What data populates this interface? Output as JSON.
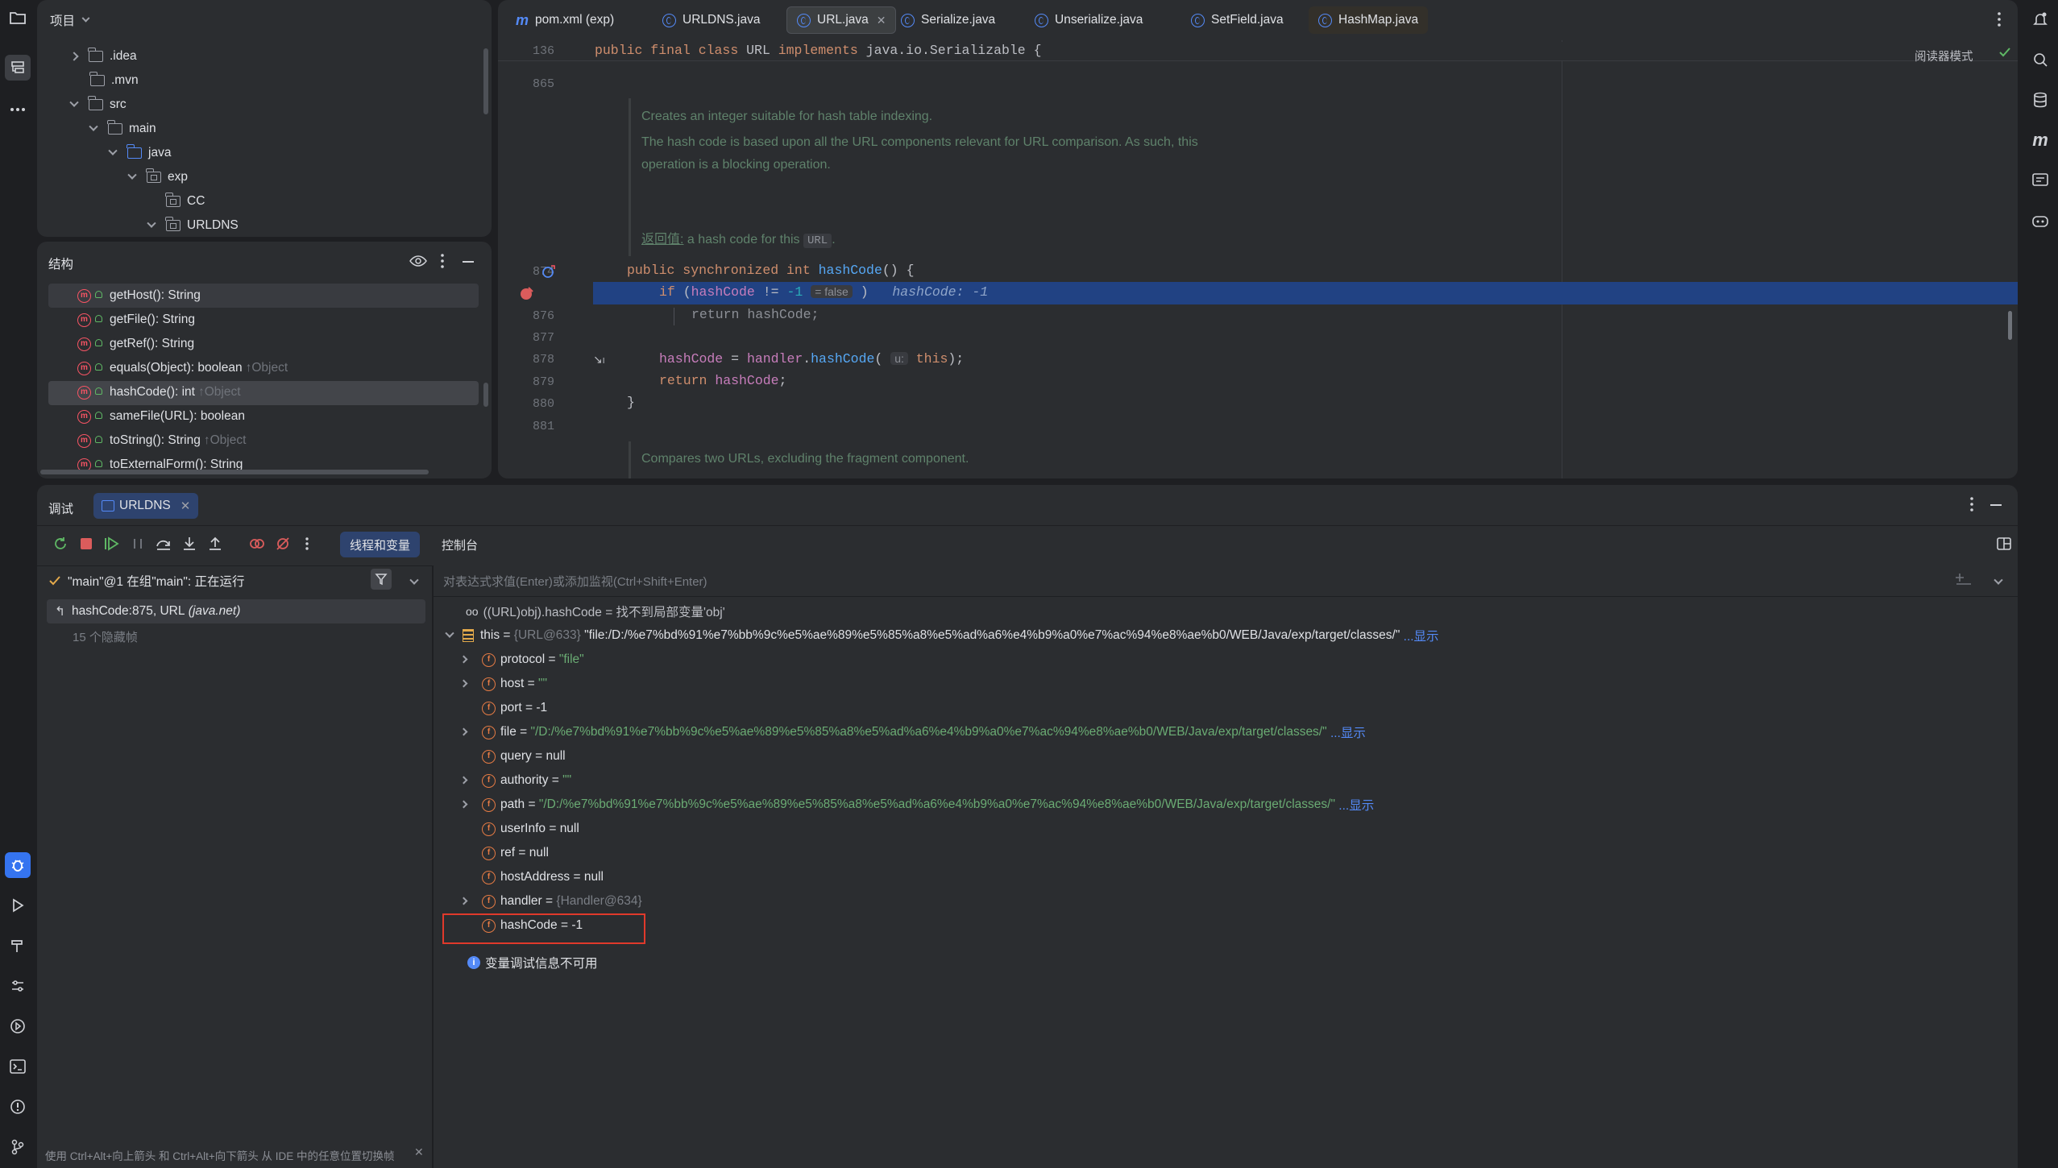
{
  "project_panel": {
    "title": "项目",
    "items": [
      ".idea",
      ".mvn",
      "src",
      "main",
      "java",
      "exp",
      "CC",
      "URLDNS"
    ]
  },
  "structure_panel": {
    "title": "结构",
    "items": [
      {
        "name": "getHost(): String",
        "suffix": ""
      },
      {
        "name": "getFile(): String",
        "suffix": ""
      },
      {
        "name": "getRef(): String",
        "suffix": ""
      },
      {
        "name": "equals(Object): boolean",
        "suffix": "↑Object"
      },
      {
        "name": "hashCode(): int",
        "suffix": "↑Object"
      },
      {
        "name": "sameFile(URL): boolean",
        "suffix": ""
      },
      {
        "name": "toString(): String",
        "suffix": "↑Object"
      },
      {
        "name": "toExternalForm(): String",
        "suffix": ""
      }
    ]
  },
  "editor": {
    "tabs": [
      "pom.xml (exp)",
      "URLDNS.java",
      "URL.java",
      "Serialize.java",
      "Unserialize.java",
      "SetField.java",
      "HashMap.java"
    ],
    "active_tab": "URL.java",
    "reader_mode": "阅读器模式",
    "sticky": {
      "line": "136",
      "code": "public final class URL implements java.io.Serializable {"
    },
    "line_numbers": {
      "l865": "865",
      "l874": "874",
      "l876": "876",
      "l877": "877",
      "l878": "878",
      "l879": "879",
      "l880": "880",
      "l881": "881"
    },
    "doc1": "Creates an integer suitable for hash table indexing.",
    "doc2": "The hash code is based upon all the URL components relevant for URL comparison. As such, this",
    "doc3": "operation is a blocking operation.",
    "doc_return_label": "返回值:",
    "doc_return_text": "a hash code for this",
    "doc_return_code": "URL",
    "doc_compare": "Compares two URLs, excluding the fragment component.",
    "inline_hint_false": "= false",
    "inline_debug": "hashCode: -1",
    "param_hint": "u:"
  },
  "debug": {
    "title": "调试",
    "session_tab": "URLDNS",
    "tab_threads": "线程和变量",
    "tab_console": "控制台",
    "thread_status": "\"main\"@1 在组\"main\": 正在运行",
    "frame": "hashCode:875, URL",
    "frame_pkg": "(java.net)",
    "hidden_frames": "15 个隐藏帧",
    "eval_placeholder": "对表达式求值(Enter)或添加监视(Ctrl+Shift+Enter)",
    "watch": "((URL)obj).hashCode = 找不到局部变量'obj'",
    "this_name": "this",
    "this_ref": "{URL@633}",
    "this_value": "\"file:/D:/%e7%bd%91%e7%bb%9c%e5%ae%89%e5%85%a8%e5%ad%a6%e4%b9%a0%e7%ac%94%e8%ae%b0/WEB/Java/exp/target/classes/\"",
    "show": "...显示",
    "fields": [
      {
        "name": "protocol",
        "eq": " = ",
        "value": "\"file\"",
        "kind": "str"
      },
      {
        "name": "host",
        "eq": " = ",
        "value": "\"\"",
        "kind": "str"
      },
      {
        "name": "port",
        "eq": " = ",
        "value": "-1",
        "kind": "plain"
      },
      {
        "name": "file",
        "eq": " = ",
        "value": "\"/D:/%e7%bd%91%e7%bb%9c%e5%ae%89%e5%85%a8%e5%ad%a6%e4%b9%a0%e7%ac%94%e8%ae%b0/WEB/Java/exp/target/classes/\"",
        "kind": "str"
      },
      {
        "name": "query",
        "eq": " = ",
        "value": "null",
        "kind": "plain"
      },
      {
        "name": "authority",
        "eq": " = ",
        "value": "\"\"",
        "kind": "str"
      },
      {
        "name": "path",
        "eq": " = ",
        "value": "\"/D:/%e7%bd%91%e7%bb%9c%e5%ae%89%e5%85%a8%e5%ad%a6%e4%b9%a0%e7%ac%94%e8%ae%b0/WEB/Java/exp/target/classes/\"",
        "kind": "str"
      },
      {
        "name": "userInfo",
        "eq": " = ",
        "value": "null",
        "kind": "plain"
      },
      {
        "name": "ref",
        "eq": " = ",
        "value": "null",
        "kind": "plain"
      },
      {
        "name": "hostAddress",
        "eq": " = ",
        "value": "null",
        "kind": "plain"
      },
      {
        "name": "handler",
        "eq": " = ",
        "value": "{Handler@634}",
        "kind": "gray"
      },
      {
        "name": "hashCode",
        "eq": " = ",
        "value": "-1",
        "kind": "plain"
      }
    ],
    "info": "变量调试信息不可用",
    "status_tip": "使用 Ctrl+Alt+向上箭头 和 Ctrl+Alt+向下箭头 从 IDE 中的任意位置切换帧"
  },
  "colors": {
    "selection": "#2e436e",
    "exec_line": "#214283",
    "highlight_box": "#e0392b"
  }
}
